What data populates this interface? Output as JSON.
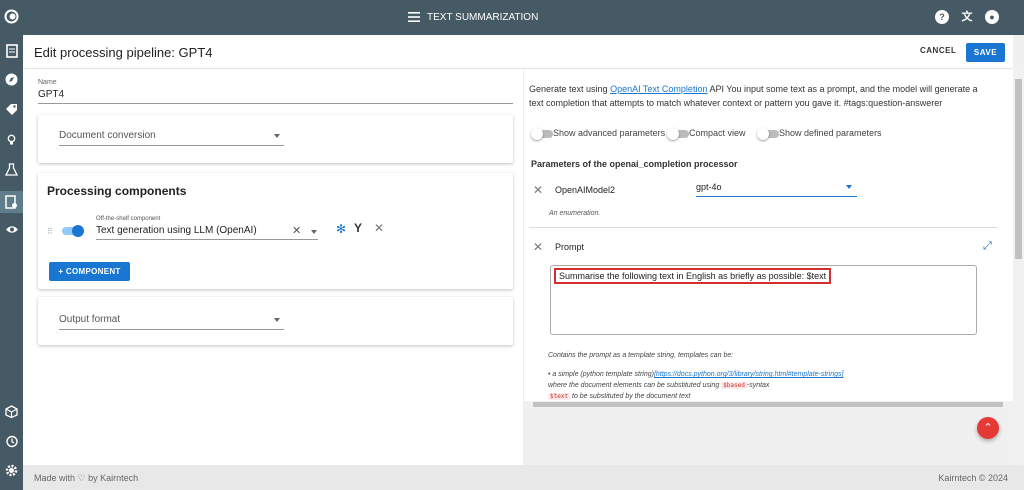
{
  "app": {
    "title": "TEXT SUMMARIZATION"
  },
  "sidebar": {
    "icons": [
      "logo-icon",
      "document-icon",
      "compass-icon",
      "tag-icon",
      "lightbulb-icon",
      "flask-icon",
      "pipeline-icon",
      "eye-icon",
      "cube-icon",
      "history-icon",
      "settings-icon"
    ]
  },
  "header": {
    "title": "Edit processing pipeline: GPT4",
    "cancel_label": "CANCEL",
    "save_label": "SAVE"
  },
  "form": {
    "name_label": "Name",
    "name_value": "GPT4",
    "document_conversion_placeholder": "Document conversion",
    "processing_title": "Processing components",
    "component_label": "Off-the-shelf component",
    "component_value": "Text generation using LLM (OpenAI)",
    "add_component_label": "COMPONENT",
    "output_format_placeholder": "Output format"
  },
  "params": {
    "desc_prefix": "Generate text using ",
    "desc_link": "OpenAI Text Completion",
    "desc_suffix": " API You input some text as a prompt, and the model will generate a text completion that attempts to match whatever context or pattern you gave it. #tags:question-answerer",
    "show_advanced": "Show advanced parameters",
    "compact_view": "Compact view",
    "show_defined": "Show defined parameters",
    "section_title": "Parameters of the openai_completion processor",
    "model_param_name": "OpenAIModel2",
    "model_value": "gpt-4o",
    "model_hint": "An enumeration.",
    "prompt_param_name": "Prompt",
    "prompt_value": "Summarise the following text in English as briefly as possible: $text",
    "prompt_desc_1": "Contains the prompt as a template string, templates can be:",
    "prompt_desc_2_prefix": "a simple (python template string)",
    "prompt_desc_2_link": "[https://docs.python.org/3/library/string.html#template-strings]",
    "prompt_desc_3_prefix": "where the document elements can be substituted using ",
    "prompt_desc_3_code": "$based",
    "prompt_desc_3_suffix": "-syntax",
    "prompt_desc_4_code": "$text",
    "prompt_desc_4_suffix": " to be substituted by the document text"
  },
  "footer": {
    "left": "Made with ♡ by Kairntech",
    "right": "Kairntech © 2024"
  },
  "colors": {
    "primary": "#1976d2",
    "sidebar": "#455a64",
    "highlight": "#d32f2f"
  }
}
